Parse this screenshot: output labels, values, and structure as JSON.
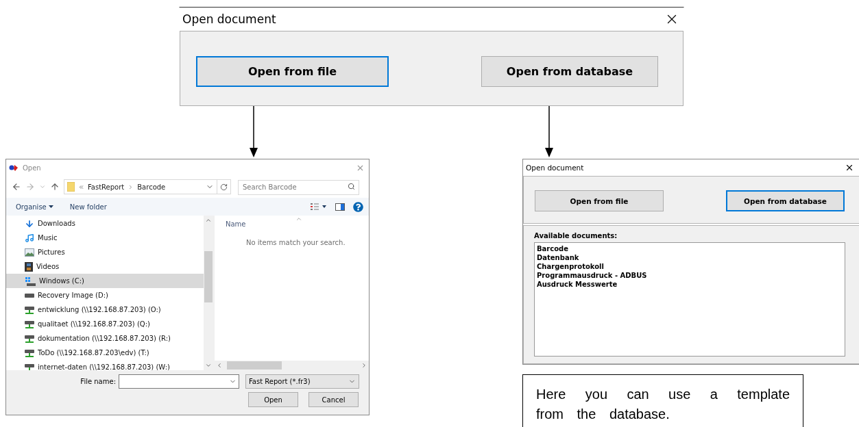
{
  "main_dialog": {
    "title": "Open document",
    "buttons": [
      {
        "label": "Open from file",
        "focused": true
      },
      {
        "label": "Open from database",
        "focused": false
      }
    ]
  },
  "file_dialog": {
    "title": "Open",
    "path": [
      "FastReport",
      "Barcode"
    ],
    "search": {
      "placeholder": "Search Barcode"
    },
    "toolbar": [
      "Organise",
      "New folder"
    ],
    "nav_items": [
      {
        "label": "Downloads",
        "kind": "downloads",
        "selected": false
      },
      {
        "label": "Music",
        "kind": "music",
        "selected": false
      },
      {
        "label": "Pictures",
        "kind": "pictures",
        "selected": false
      },
      {
        "label": "Videos",
        "kind": "videos",
        "selected": false
      },
      {
        "label": "Windows (C:)",
        "kind": "system-drive",
        "selected": true
      },
      {
        "label": "Recovery Image (D:)",
        "kind": "drive",
        "selected": false
      },
      {
        "label": "entwicklung (\\\\192.168.87.203) (O:)",
        "kind": "network-drive",
        "selected": false
      },
      {
        "label": "qualitaet (\\\\192.168.87.203) (Q:)",
        "kind": "network-drive",
        "selected": false
      },
      {
        "label": "dokumentation (\\\\192.168.87.203) (R:)",
        "kind": "network-drive",
        "selected": false
      },
      {
        "label": "ToDo (\\\\192.168.87.203\\edv) (T:)",
        "kind": "network-drive",
        "selected": false
      },
      {
        "label": "internet-daten (\\\\192.168.87.203) (W:)",
        "kind": "network-drive",
        "selected": false
      }
    ],
    "column": "Name",
    "empty_message": "No items match your search.",
    "file_name_label": "File name:",
    "file_type": "Fast Report (*.fr3)",
    "buttons": [
      "Open",
      "Cancel"
    ]
  },
  "database_dialog": {
    "title": "Open document",
    "buttons": [
      {
        "label": "Open from file",
        "focused": false
      },
      {
        "label": "Open from database",
        "focused": true
      }
    ],
    "list_label": "Available documents:",
    "documents": [
      "Barcode",
      "Datenbank",
      "Chargenprotokoll",
      "Programmausdruck - ADBUS",
      "Ausdruck Messwerte"
    ]
  },
  "callout": {
    "text": "Here you can use a template from the database."
  }
}
